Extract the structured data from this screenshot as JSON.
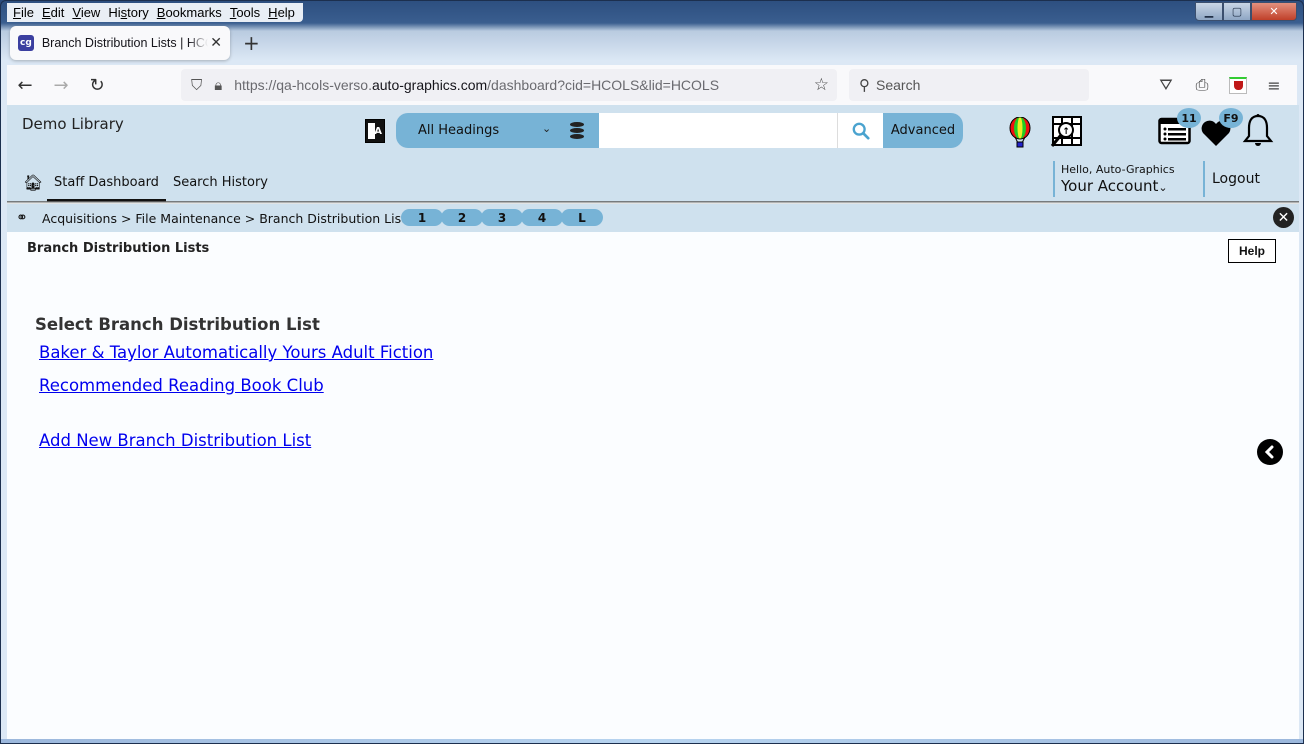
{
  "browser": {
    "menu": [
      "File",
      "Edit",
      "View",
      "History",
      "Bookmarks",
      "Tools",
      "Help"
    ],
    "menu_access_keys": [
      "F",
      "E",
      "V",
      "s",
      "B",
      "T",
      "H"
    ],
    "tab": {
      "favicon": "cg",
      "title": "Branch Distribution Lists | HCOLS"
    },
    "url": {
      "prefix": "https://qa-hcols-verso.",
      "domain": "auto-graphics.com",
      "path": "/dashboard?cid=HCOLS&lid=HCOLS"
    },
    "search_placeholder": "Search"
  },
  "header": {
    "library_name": "Demo Library",
    "search_scope": "All Headings",
    "search_value": "",
    "advanced_label": "Advanced",
    "badges": {
      "list_count": "11",
      "favorites": "F9"
    },
    "greeting": "Hello, Auto-Graphics",
    "account_label": "Your Account",
    "logout_label": "Logout"
  },
  "nav": {
    "items": [
      {
        "label": "Staff Dashboard",
        "active": true
      },
      {
        "label": "Search History",
        "active": false
      }
    ]
  },
  "breadcrumb": {
    "text": "Acquisitions > File Maintenance > Branch Distribution Lists",
    "pages": [
      "1",
      "2",
      "3",
      "4",
      "L"
    ]
  },
  "content": {
    "title": "Branch Distribution Lists",
    "help_label": "Help",
    "section_heading": "Select Branch Distribution List",
    "lists": [
      "Baker & Taylor Automatically Yours Adult Fiction",
      "Recommended Reading Book Club"
    ],
    "add_new_label": "Add New Branch Distribution List"
  }
}
